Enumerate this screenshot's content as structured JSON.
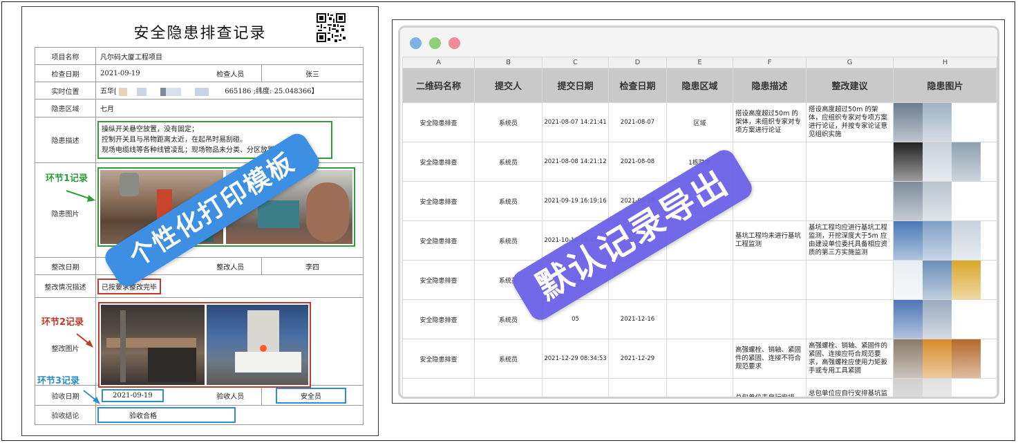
{
  "form": {
    "title": "安全隐患排查记录",
    "labels": {
      "project": "项目名称",
      "check_date": "检查日期",
      "inspector": "检查人员",
      "location": "实时位置",
      "area": "隐患区域",
      "description": "隐患描述",
      "hazard_photo": "隐患图片",
      "fix_date": "整改日期",
      "fixer": "整改人员",
      "fix_desc": "整改情况描述",
      "fix_photo": "整改图片",
      "accept_date": "验收日期",
      "acceptor": "验收人员",
      "conclusion": "验收结论"
    },
    "values": {
      "project": "凡尔码大厦工程项目",
      "check_date": "2021-09-19",
      "inspector": "张三",
      "location_prefix": "五华[",
      "location_suffix": "665186 ;纬度: 25.048366】",
      "area": "七月",
      "description_lines": [
        "操纵开关悬空放置，没有固定；",
        "控制开关且与吊物距离太近，在起吊时易刮碰。",
        "现场电缆线等各种线管凌乱；现场物品未分类、分区放置"
      ],
      "fixer": "李四",
      "fix_desc": "已按要求整改完毕",
      "accept_date": "2021-09-19",
      "acceptor": "安全员",
      "conclusion": "验收合格"
    },
    "annotations": {
      "step1": "环节1记录",
      "step2": "环节2记录",
      "step3": "环节3记录"
    },
    "stamp": "个性化打印模板"
  },
  "sheet": {
    "window_dots": [
      "#7fb3e6",
      "#8fcf7a",
      "#ef8a9a"
    ],
    "column_letters": [
      "A",
      "B",
      "C",
      "D",
      "E",
      "F",
      "G",
      "H"
    ],
    "headers": [
      "二维码名称",
      "提交人",
      "提交日期",
      "检查日期",
      "隐患区域",
      "隐患描述",
      "整改建议",
      "隐患图片"
    ],
    "rows": [
      {
        "name": "安全隐患排查",
        "submitter": "系统员",
        "submit_date": "2021-08-07 14:21:41",
        "check_date": "2021-08-07",
        "area": "区域",
        "desc": "搭设高度超过50m 的架体，未组织专家对专项方案进行论证",
        "advice": "搭设高度超过50m 的架体，应组织专家对专项方案进行论证，并按专家论证意见组织实施"
      },
      {
        "name": "安全隐患排查",
        "submitter": "系统员",
        "submit_date": "2021-08-08 14:21:12",
        "check_date": "2021-08-08",
        "area": "1栋隐患",
        "desc": "",
        "advice": ""
      },
      {
        "name": "安全隐患排查",
        "submitter": "系统员",
        "submit_date": "2021-09-19 16:19:16",
        "check_date": "2021-09-19",
        "area": "",
        "desc": "",
        "advice": ""
      },
      {
        "name": "安全隐患排查",
        "submitter": "系统员",
        "submit_date": "2021-10-10 18:47:13",
        "check_date": "",
        "area": "",
        "desc": "基坑工程均未进行基坑工程监测",
        "advice": "基坑工程均应进行基坑工程监测，开挖深度大于5m 应由建设单位委托具备相应资质的第三方实施监测"
      },
      {
        "name": "安全隐患排查",
        "submitter": "系统员",
        "submit_date": "202",
        "check_date": "",
        "area": "",
        "desc": "",
        "advice": ""
      },
      {
        "name": "安全隐患排查",
        "submitter": "系统员",
        "submit_date": "05",
        "check_date": "2021-12-16",
        "area": "",
        "desc": "",
        "advice": ""
      },
      {
        "name": "安全隐患排查",
        "submitter": "系统员",
        "submit_date": "2021-12-29 08:34:53",
        "check_date": "2021-12-29",
        "area": "",
        "desc": "高强螺栓、销轴、紧固件的紧固、连接不符合规范要求",
        "advice": "高强螺栓、销轴、紧固件的紧固、连接应符合规范要求，高强螺栓应使用力矩扳手或专用工具紧固"
      },
      {
        "name": "",
        "submitter": "",
        "submit_date": "",
        "check_date": "",
        "area": "",
        "desc": "总包单位未自行安排",
        "advice": "总包单位应自行安排基坑监测工作，并与第三方监"
      }
    ],
    "stamp": "默认记录导出"
  }
}
